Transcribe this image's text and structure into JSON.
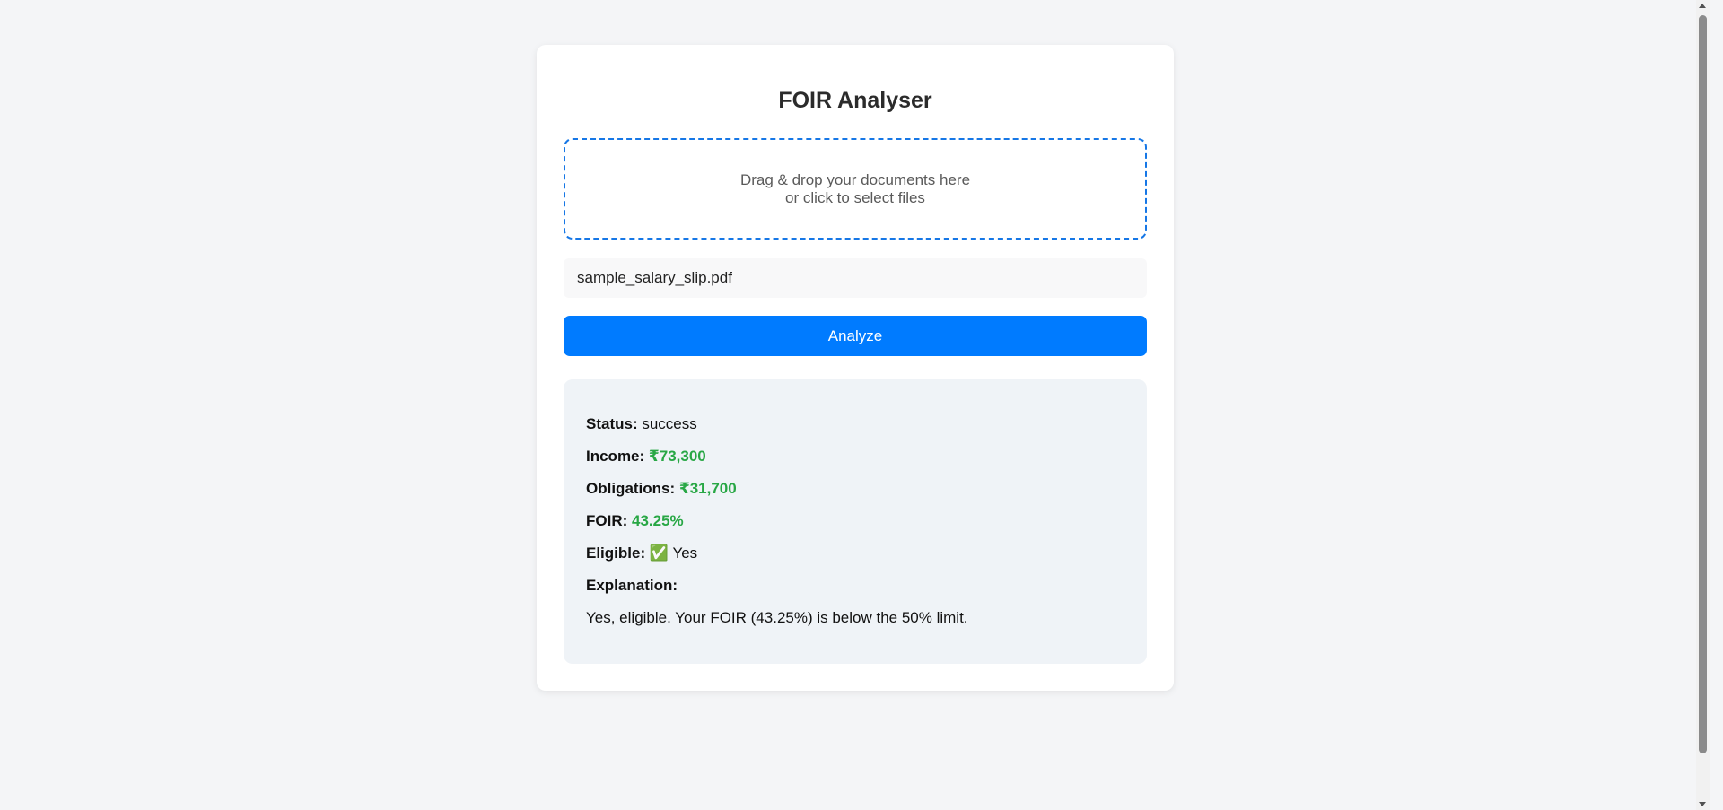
{
  "app": {
    "title": "FOIR Analyser"
  },
  "dropzone": {
    "line1": "Drag & drop your documents here",
    "line2": "or click to select files"
  },
  "file": {
    "name": "sample_salary_slip.pdf"
  },
  "actions": {
    "analyze_label": "Analyze"
  },
  "result": {
    "status_label": "Status:",
    "status_value": "success",
    "income_label": "Income:",
    "income_value": "₹73,300",
    "obligations_label": "Obligations:",
    "obligations_value": "₹31,700",
    "foir_label": "FOIR:",
    "foir_value": "43.25%",
    "eligible_label": "Eligible:",
    "eligible_icon": "✅",
    "eligible_value": "Yes",
    "explanation_label": "Explanation:",
    "explanation_text": "Yes, eligible. Your FOIR (43.25%) is below the 50% limit."
  },
  "colors": {
    "accent": "#007bff",
    "success": "#28a745",
    "background": "#f4f5f7"
  }
}
